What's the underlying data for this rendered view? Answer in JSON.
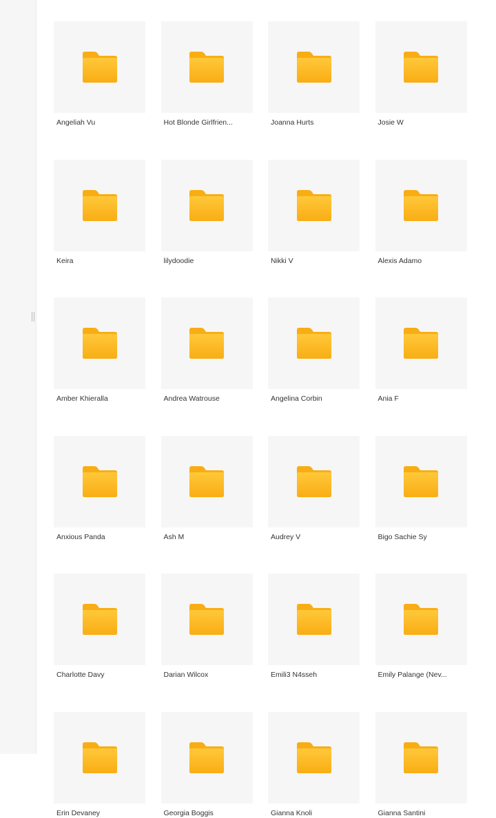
{
  "folder_color": "#f9ad14",
  "folder_color_light": "#ffc83a",
  "folders": [
    {
      "name": "Angeliah Vu"
    },
    {
      "name": "Hot Blonde Girlfrien..."
    },
    {
      "name": "Joanna Hurts"
    },
    {
      "name": "Josie W"
    },
    {
      "name": "Keira"
    },
    {
      "name": "lilydoodie"
    },
    {
      "name": "Nikki V"
    },
    {
      "name": "Alexis Adamo"
    },
    {
      "name": "Amber Khieralla"
    },
    {
      "name": "Andrea Watrouse"
    },
    {
      "name": "Angelina Corbin"
    },
    {
      "name": "Ania F"
    },
    {
      "name": "Anxious Panda"
    },
    {
      "name": "Ash M"
    },
    {
      "name": "Audrey V"
    },
    {
      "name": "Bigo Sachie Sy"
    },
    {
      "name": "Charlotte Davy"
    },
    {
      "name": "Darian Wilcox"
    },
    {
      "name": "Emili3 N4sseh"
    },
    {
      "name": "Emily Palange (Nev..."
    },
    {
      "name": "Erin Devaney"
    },
    {
      "name": "Georgia Boggis"
    },
    {
      "name": "Gianna Knoli"
    },
    {
      "name": "Gianna Santini"
    }
  ]
}
